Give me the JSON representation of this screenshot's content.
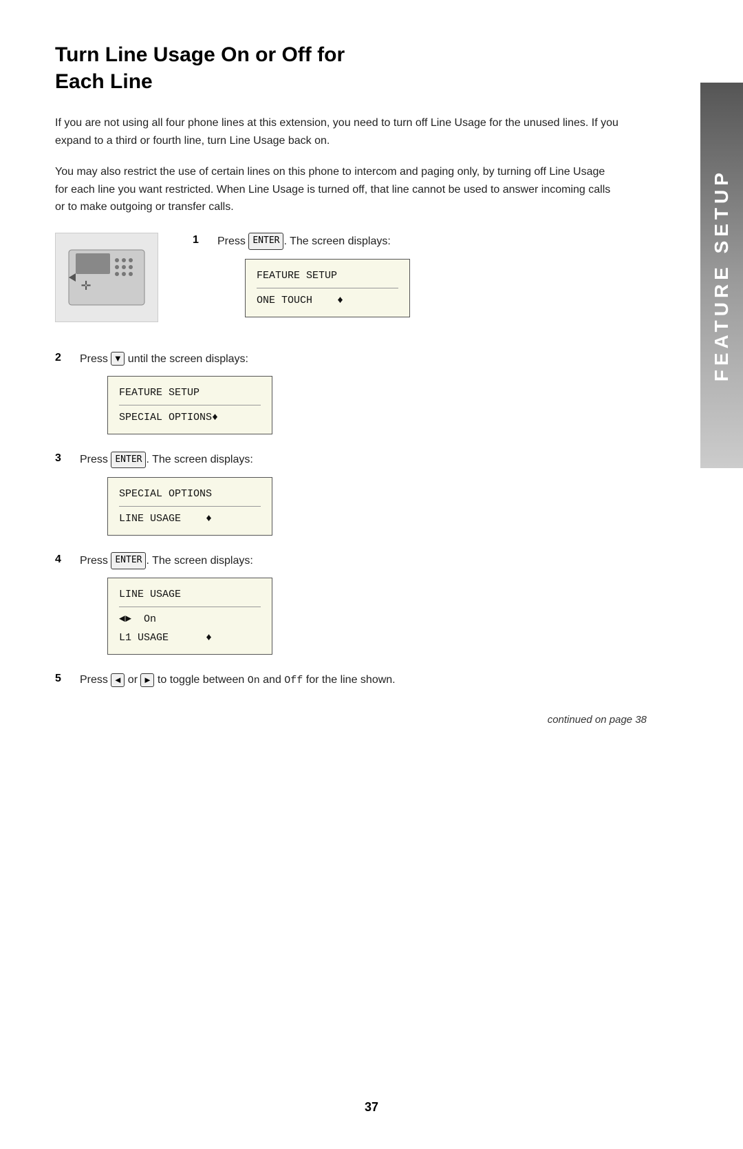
{
  "page": {
    "number": "37",
    "sidebar_label": "FEATURE SETUP",
    "continued_text": "continued on page 38"
  },
  "title": {
    "line1": "Turn Line Usage On or Off for",
    "line2": "Each Line"
  },
  "body_paragraphs": [
    "If you are not using all four phone lines at this extension, you need to turn off Line Usage for the unused lines. If you expand to a third or fourth line, turn Line Usage back on.",
    "You may also restrict the use of certain lines on this phone to intercom and paging only, by turning off Line Usage for each line you want restricted. When Line Usage is turned off, that line cannot be used to answer incoming calls or to make outgoing or transfer calls."
  ],
  "steps": [
    {
      "number": "1",
      "text_parts": [
        "Press ",
        "ENTER",
        ". The screen displays:"
      ],
      "has_image": true,
      "lcd": {
        "line1": "FEATURE SETUP",
        "line2": "ONE TOUCH    ♦"
      }
    },
    {
      "number": "2",
      "text_parts": [
        "Press ",
        "▼",
        " until the screen displays:"
      ],
      "lcd": {
        "line1": "FEATURE SETUP",
        "line2": "SPECIAL OPTIONS♦"
      }
    },
    {
      "number": "3",
      "text_parts": [
        "Press ",
        "ENTER",
        ". The screen displays:"
      ],
      "lcd": {
        "line1": "SPECIAL OPTIONS",
        "line2": "LINE USAGE    ♦"
      }
    },
    {
      "number": "4",
      "text_parts": [
        "Press ",
        "ENTER",
        ". The screen displays:"
      ],
      "lcd": {
        "line1": "LINE USAGE",
        "line2": "◄►  On",
        "line3": "L1 USAGE      ♦"
      }
    },
    {
      "number": "5",
      "text_parts": [
        "Press ",
        "◄",
        " or ",
        "►",
        " to toggle between ",
        "On",
        " and ",
        "Off",
        " for the line shown."
      ]
    }
  ]
}
